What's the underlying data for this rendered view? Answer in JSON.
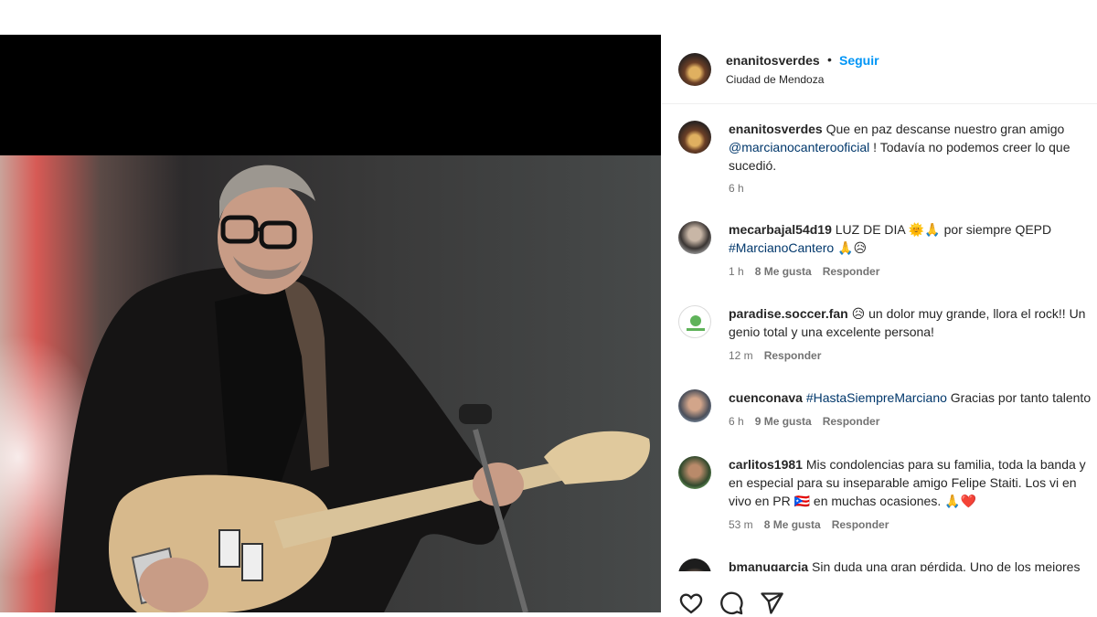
{
  "post": {
    "author": "enanitosverdes",
    "separator": "•",
    "follow_label": "Seguir",
    "location": "Ciudad de Mendoza"
  },
  "caption": {
    "user": "enanitosverdes",
    "line1": "Que en paz descanse nuestro gran amigo",
    "mention": "@marcianocanterooficial",
    "line2_rest": "! Todavía no podemos creer lo que",
    "line3": "sucedió.",
    "time": "6 h"
  },
  "comments": [
    {
      "user": "mecarbajal54d19",
      "text1": "LUZ DE DIA 🌞🙏 por siempre QEPD",
      "tag": "#MarcianoCantero",
      "text2_rest": "🙏😥",
      "time": "1 h",
      "likes": "8 Me gusta",
      "reply": "Responder"
    },
    {
      "user": "paradise.soccer.fan",
      "text1": "😥 un dolor muy grande, llora el rock!! Un",
      "text2": "genio total y una excelente persona!",
      "time": "12 m",
      "reply": "Responder"
    },
    {
      "user": "cuenconava",
      "tag": "#HastaSiempreMarciano",
      "text1": "Gracias por tanto talento",
      "time": "6 h",
      "likes": "9 Me gusta",
      "reply": "Responder"
    },
    {
      "user": "carlitos1981",
      "text1": "Mis condolencias para su familia, toda la banda y",
      "text2": "en especial para su inseparable amigo Felipe Staiti. Los vi en",
      "text3": "vivo en PR 🇵🇷 en muchas ocasiones. 🙏❤️",
      "time": "53 m",
      "likes": "8 Me gusta",
      "reply": "Responder"
    },
    {
      "user": "bmanugarcia",
      "text1": "Sin duda una gran pérdida. Uno de los mejores"
    }
  ],
  "icons": {
    "like": "heart-icon",
    "comment": "comment-icon",
    "share": "share-icon"
  },
  "colors": {
    "link_blue": "#0095f6",
    "tag_blue": "#00376b",
    "muted": "#737373"
  }
}
